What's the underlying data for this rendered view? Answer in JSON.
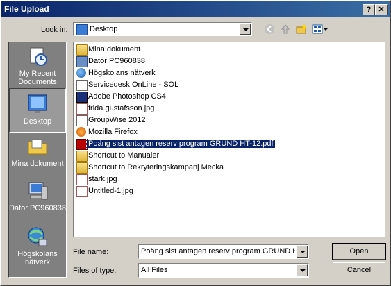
{
  "window": {
    "title": "File Upload",
    "help_glyph": "?",
    "close_glyph": "✕"
  },
  "toolbar": {
    "look_in_label": "Look in:",
    "look_in_value": "Desktop",
    "back_icon": "back-arrow-icon",
    "up_icon": "up-folder-icon",
    "new_folder_icon": "new-folder-icon",
    "views_icon": "views-menu-icon"
  },
  "places": [
    {
      "label": "My Recent Documents",
      "icon": "recent-documents-icon"
    },
    {
      "label": "Desktop",
      "icon": "desktop-icon",
      "selected": true
    },
    {
      "label": "Mina dokument",
      "icon": "folder-icon"
    },
    {
      "label": "Dator PC960838",
      "icon": "computer-icon"
    },
    {
      "label": "Högskolans nätverk",
      "icon": "network-icon"
    }
  ],
  "files": [
    {
      "name": "Mina dokument",
      "icon": "folder"
    },
    {
      "name": "Dator PC960838",
      "icon": "pc"
    },
    {
      "name": "Högskolans nätverk",
      "icon": "net"
    },
    {
      "name": "Servicedesk OnLine - SOL",
      "icon": "doc"
    },
    {
      "name": "Adobe Photoshop CS4",
      "icon": "ps"
    },
    {
      "name": "frida.gustafsson.jpg",
      "icon": "jpg"
    },
    {
      "name": "GroupWise 2012",
      "icon": "doc"
    },
    {
      "name": "Mozilla Firefox",
      "icon": "ff"
    },
    {
      "name": "Poäng sist antagen reserv program GRUND HT-12.pdf",
      "icon": "pdf",
      "selected": true
    },
    {
      "name": "Shortcut to Manualer",
      "icon": "folder"
    },
    {
      "name": "Shortcut to Rekryteringskampanj Mecka",
      "icon": "folder"
    },
    {
      "name": "stark.jpg",
      "icon": "jpg"
    },
    {
      "name": "Untitled-1.jpg",
      "icon": "jpg"
    }
  ],
  "footer": {
    "file_name_label": "File name:",
    "file_name_value": "Poäng sist antagen reserv program GRUND HT",
    "file_type_label": "Files of type:",
    "file_type_value": "All Files",
    "open_label": "Open",
    "cancel_label": "Cancel"
  }
}
